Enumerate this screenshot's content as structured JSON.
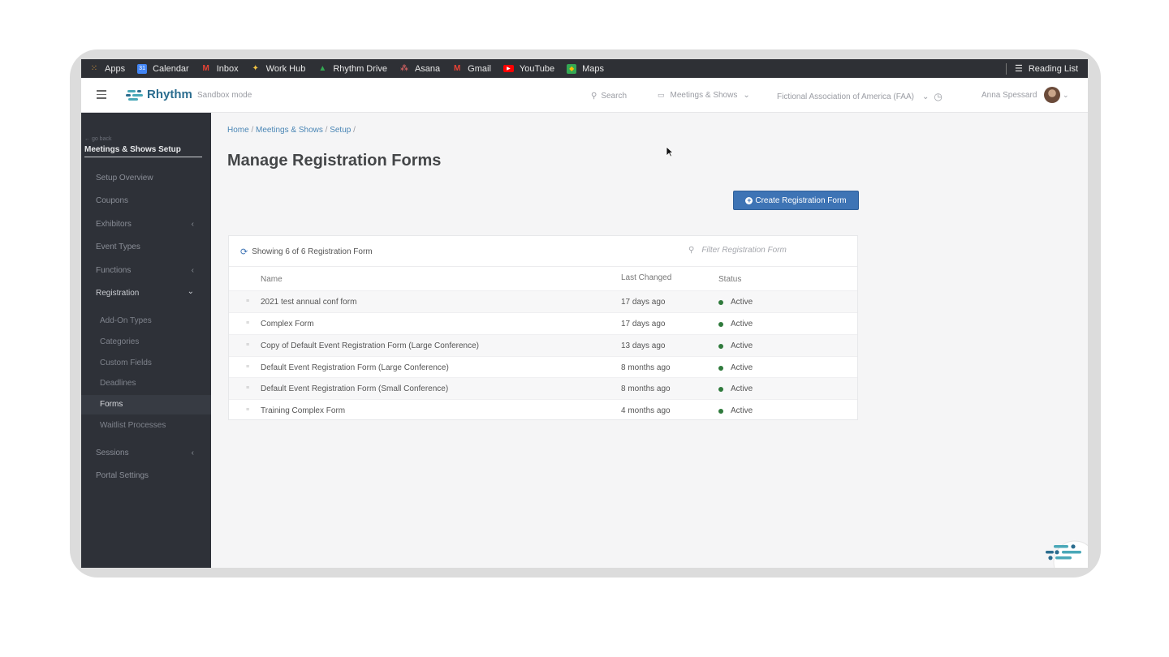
{
  "bookmarks": [
    {
      "label": "Apps",
      "icon": "apps-grid-icon",
      "color": "#e8a33d"
    },
    {
      "label": "Calendar",
      "icon": "calendar-icon",
      "color": "#4285f4"
    },
    {
      "label": "Inbox",
      "icon": "gmail-icon",
      "color": "#ea4335"
    },
    {
      "label": "Work Hub",
      "icon": "sparkle-icon",
      "color": "#f4c542"
    },
    {
      "label": "Rhythm Drive",
      "icon": "drive-icon",
      "color": "#34a853"
    },
    {
      "label": "Asana",
      "icon": "asana-icon",
      "color": "#f06a6a"
    },
    {
      "label": "Gmail",
      "icon": "gmail-icon",
      "color": "#ea4335"
    },
    {
      "label": "YouTube",
      "icon": "youtube-icon",
      "color": "#ff0000"
    },
    {
      "label": "Maps",
      "icon": "maps-icon",
      "color": "#34a853"
    }
  ],
  "reading_list": "Reading List",
  "header": {
    "brand": "Rhythm",
    "mode": "Sandbox mode",
    "search_placeholder": "Search",
    "module": "Meetings & Shows",
    "organization": "Fictional Association of America (FAA)",
    "user": "Anna Spessard"
  },
  "sidebar": {
    "go_back": "go back",
    "title": "Meetings & Shows Setup",
    "items": [
      {
        "label": "Setup Overview"
      },
      {
        "label": "Coupons"
      },
      {
        "label": "Exhibitors",
        "caret": "‹"
      },
      {
        "label": "Event Types"
      },
      {
        "label": "Functions",
        "caret": "‹"
      },
      {
        "label": "Registration",
        "caret": "⌄"
      }
    ],
    "sub_items": [
      "Add-On Types",
      "Categories",
      "Custom Fields",
      "Deadlines",
      "Forms",
      "Waitlist Processes"
    ],
    "lower_items": [
      {
        "label": "Sessions",
        "caret": "‹"
      },
      {
        "label": "Portal Settings"
      }
    ],
    "active": "Forms"
  },
  "breadcrumb": {
    "home": "Home",
    "module": "Meetings & Shows",
    "setup": "Setup"
  },
  "page_title": "Manage Registration Forms",
  "create_button": "Create Registration Form",
  "table": {
    "showing": "Showing 6 of 6 Registration Form",
    "filter_placeholder": "Filter Registration Form",
    "columns": {
      "name": "Name",
      "last_changed": "Last Changed",
      "status": "Status"
    },
    "rows": [
      {
        "name": "2021 test annual conf form",
        "last_changed": "17 days ago",
        "status": "Active"
      },
      {
        "name": "Complex Form",
        "last_changed": "17 days ago",
        "status": "Active"
      },
      {
        "name": "Copy of Default Event Registration Form (Large Conference)",
        "last_changed": "13 days ago",
        "status": "Active"
      },
      {
        "name": "Default Event Registration Form (Large Conference)",
        "last_changed": "8 months ago",
        "status": "Active"
      },
      {
        "name": "Default Event Registration Form (Small Conference)",
        "last_changed": "8 months ago",
        "status": "Active"
      },
      {
        "name": "Training Complex Form",
        "last_changed": "4 months ago",
        "status": "Active"
      }
    ]
  },
  "colors": {
    "accent": "#3e74b5",
    "sidebar": "#2e3138",
    "status_active": "#2f7a3c"
  }
}
